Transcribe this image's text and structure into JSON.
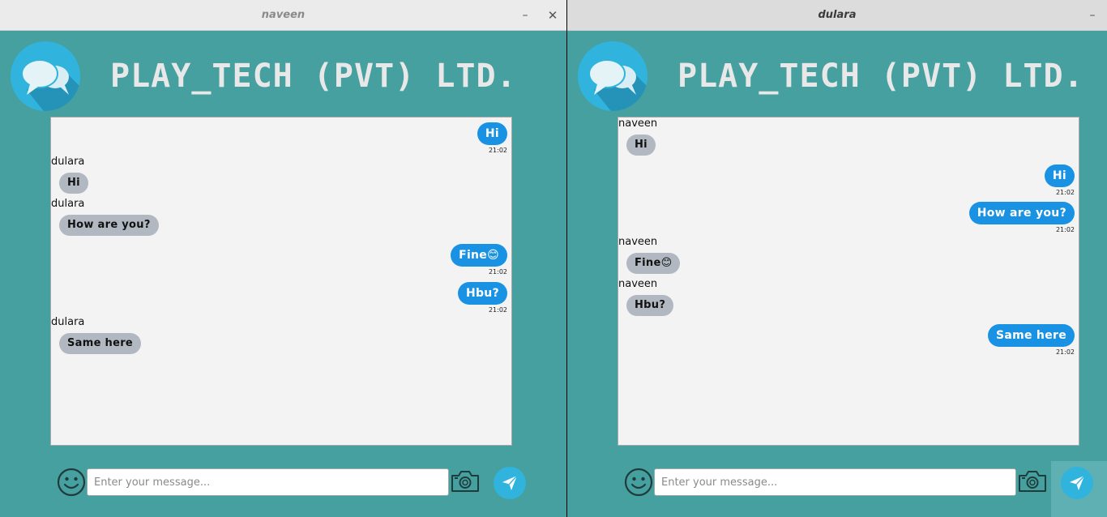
{
  "colors": {
    "window_bg": "#47a0a0",
    "chat_bg": "#f3f3f3",
    "outgoing_bubble": "#1a92e3",
    "incoming_bubble": "#b1b8c1",
    "logo": "#30b4dd"
  },
  "windows": [
    {
      "title": "naveen",
      "minimize_label": "–",
      "close_label": "✕",
      "header": {
        "company": "PLAY_TECH (PVT) LTD.",
        "logo_icon": "chat-bubbles-icon"
      },
      "messages": [
        {
          "dir": "out",
          "text": "Hi",
          "time": "21:02"
        },
        {
          "dir": "in",
          "sender": "dulara",
          "text": "Hi"
        },
        {
          "dir": "in",
          "sender": "dulara",
          "text": "How are you?"
        },
        {
          "dir": "out",
          "text": "Fine😊",
          "time": "21:02"
        },
        {
          "dir": "out",
          "text": "Hbu?",
          "time": "21:02"
        },
        {
          "dir": "in",
          "sender": "dulara",
          "text": "Same here"
        }
      ],
      "input": {
        "placeholder": "Enter your message...",
        "value": ""
      },
      "icons": {
        "emoji": "smiley-icon",
        "camera": "camera-icon",
        "send": "send-icon"
      }
    },
    {
      "title": "dulara",
      "minimize_label": "–",
      "header": {
        "company": "PLAY_TECH (PVT) LTD.",
        "logo_icon": "chat-bubbles-icon"
      },
      "messages": [
        {
          "dir": "in",
          "sender": "naveen",
          "text": "Hi"
        },
        {
          "dir": "out",
          "text": "Hi",
          "time": "21:02"
        },
        {
          "dir": "out",
          "text": "How are you?",
          "time": "21:02"
        },
        {
          "dir": "in",
          "sender": "naveen",
          "text": "Fine😊"
        },
        {
          "dir": "in",
          "sender": "naveen",
          "text": "Hbu?"
        },
        {
          "dir": "out",
          "text": "Same here",
          "time": "21:02"
        }
      ],
      "input": {
        "placeholder": "Enter your message...",
        "value": ""
      },
      "icons": {
        "emoji": "smiley-icon",
        "camera": "camera-icon",
        "send": "send-icon"
      }
    }
  ]
}
